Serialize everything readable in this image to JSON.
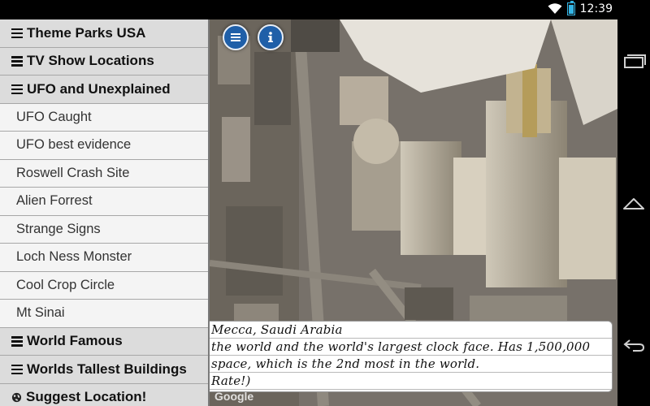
{
  "status": {
    "time": "12:39"
  },
  "menu": {
    "items": [
      {
        "label": "Theme Parks USA",
        "type": "category",
        "icon": "menu-icon"
      },
      {
        "label": "TV Show Locations",
        "type": "category",
        "icon": "menu-icon"
      },
      {
        "label": "UFO and Unexplained",
        "type": "category",
        "icon": "menu-icon"
      },
      {
        "label": "UFO Caught",
        "type": "item"
      },
      {
        "label": "UFO best evidence",
        "type": "item"
      },
      {
        "label": "Roswell Crash Site",
        "type": "item"
      },
      {
        "label": "Alien Forrest",
        "type": "item"
      },
      {
        "label": "Strange Signs",
        "type": "item"
      },
      {
        "label": "Loch Ness Monster",
        "type": "item"
      },
      {
        "label": "Cool Crop Circle",
        "type": "item"
      },
      {
        "label": "Mt Sinai",
        "type": "item"
      },
      {
        "label": "World Famous",
        "type": "category",
        "icon": "menu-icon"
      },
      {
        "label": "Worlds Tallest Buildings",
        "type": "category",
        "icon": "menu-icon"
      },
      {
        "label": "Suggest Location!",
        "type": "category",
        "icon": "globe-icon"
      }
    ]
  },
  "map": {
    "watermark": "Google",
    "buttons": [
      {
        "icon": "list-icon"
      },
      {
        "icon": "info-icon"
      }
    ]
  },
  "caption": {
    "lines": [
      "Mecca, Saudi Arabia",
      "the world and the world's largest clock face. Has 1,500,000",
      "space, which is the 2nd most in the world.",
      "Rate!)"
    ]
  },
  "colors": {
    "accent": "#33b5e5",
    "menu_bg": "#dcdcdc",
    "map_button": "#1f5fa8"
  }
}
